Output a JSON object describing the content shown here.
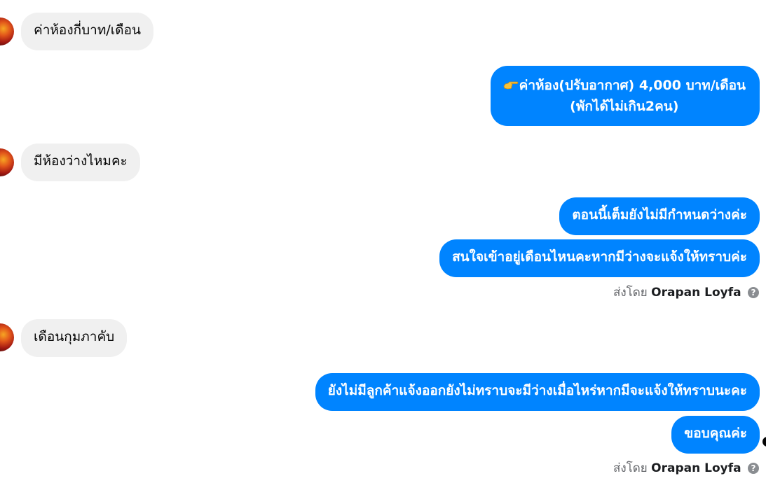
{
  "messages": [
    {
      "side": "in",
      "text": "ค่าห้องกี่บาท/เดือน"
    },
    {
      "side": "out",
      "lines": [
        "ค่าห้อง(ปรับอากาศ) 4,000 บาท/เดือน",
        "(พักได้ไม่เกิน2คน)"
      ],
      "icon": "pointing-hand-icon"
    },
    {
      "side": "in",
      "text": "มีห้องว่างไหมคะ"
    },
    {
      "side": "out",
      "text": "ตอนนี้เต็มยังไม่มีกำหนดว่างค่ะ"
    },
    {
      "side": "out",
      "text": "สนใจเข้าอยู่เดือนไหนคะหากมีว่างจะแจ้งให้ทราบค่ะ"
    },
    {
      "side": "in",
      "text": "เดือนกุมภาคับ"
    },
    {
      "side": "out",
      "text": "ยังไม่มีลูกค้าแจ้งออกยังไม่ทราบจะมีว่างเมื่อไหร่หากมีจะแจ้งให้ทราบนะคะ"
    },
    {
      "side": "out",
      "text": "ขอบคุณค่ะ"
    }
  ],
  "sent_by": [
    {
      "label": "ส่งโดย",
      "sender": "Orapan Loyfa",
      "icon": "question-circle-icon"
    },
    {
      "label": "ส่งโดย",
      "sender": "Orapan Loyfa",
      "icon": "question-circle-icon"
    }
  ],
  "colors": {
    "outgoing_bubble": "#0084ff",
    "incoming_bubble": "#f0f0f0",
    "meta_text": "#65676b"
  }
}
